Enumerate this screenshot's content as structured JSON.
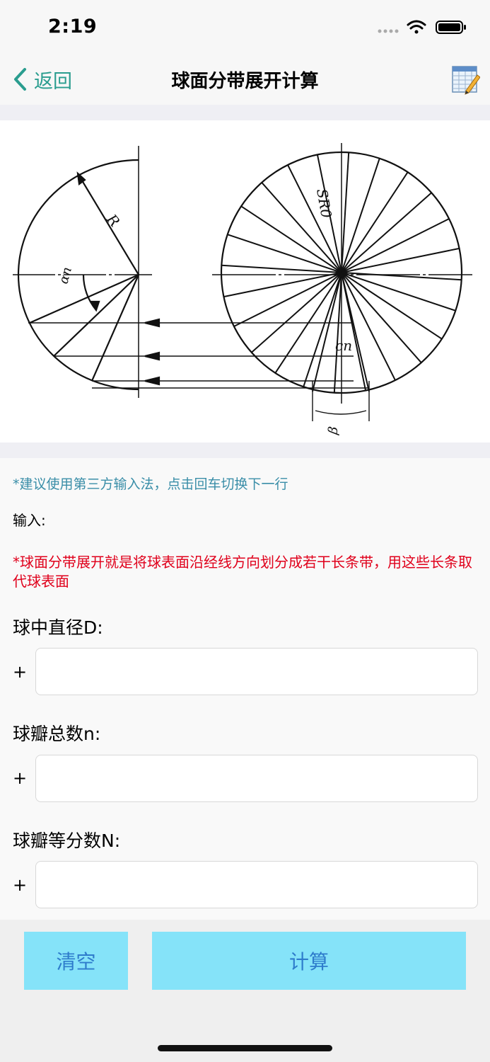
{
  "status_bar": {
    "time": "2:19"
  },
  "nav": {
    "back_label": "返回",
    "title": "球面分带展开计算"
  },
  "figure": {
    "label_R": "R",
    "label_alpha": "αn",
    "label_SR": "SR0",
    "label_c": "cn",
    "label_beta": "β"
  },
  "form": {
    "hint": "*建议使用第三方输入法，点击回车切换下一行",
    "input_title": "输入:",
    "description": "*球面分带展开就是将球表面沿经线方向划分成若干长条带，用这些长条取代球表面",
    "fields": [
      {
        "label": "球中直径D:",
        "prefix": "+",
        "value": ""
      },
      {
        "label": "球瓣总数n:",
        "prefix": "+",
        "value": ""
      },
      {
        "label": "球瓣等分数N:",
        "prefix": "+",
        "value": ""
      }
    ]
  },
  "buttons": {
    "clear_label": "清空",
    "calc_label": "计算"
  },
  "colors": {
    "accent_teal": "#2a9d8f",
    "hint_blue": "#3a8ea8",
    "warning_red": "#e0001b",
    "button_bg": "#85e3f9",
    "button_text": "#2e7ccc"
  }
}
